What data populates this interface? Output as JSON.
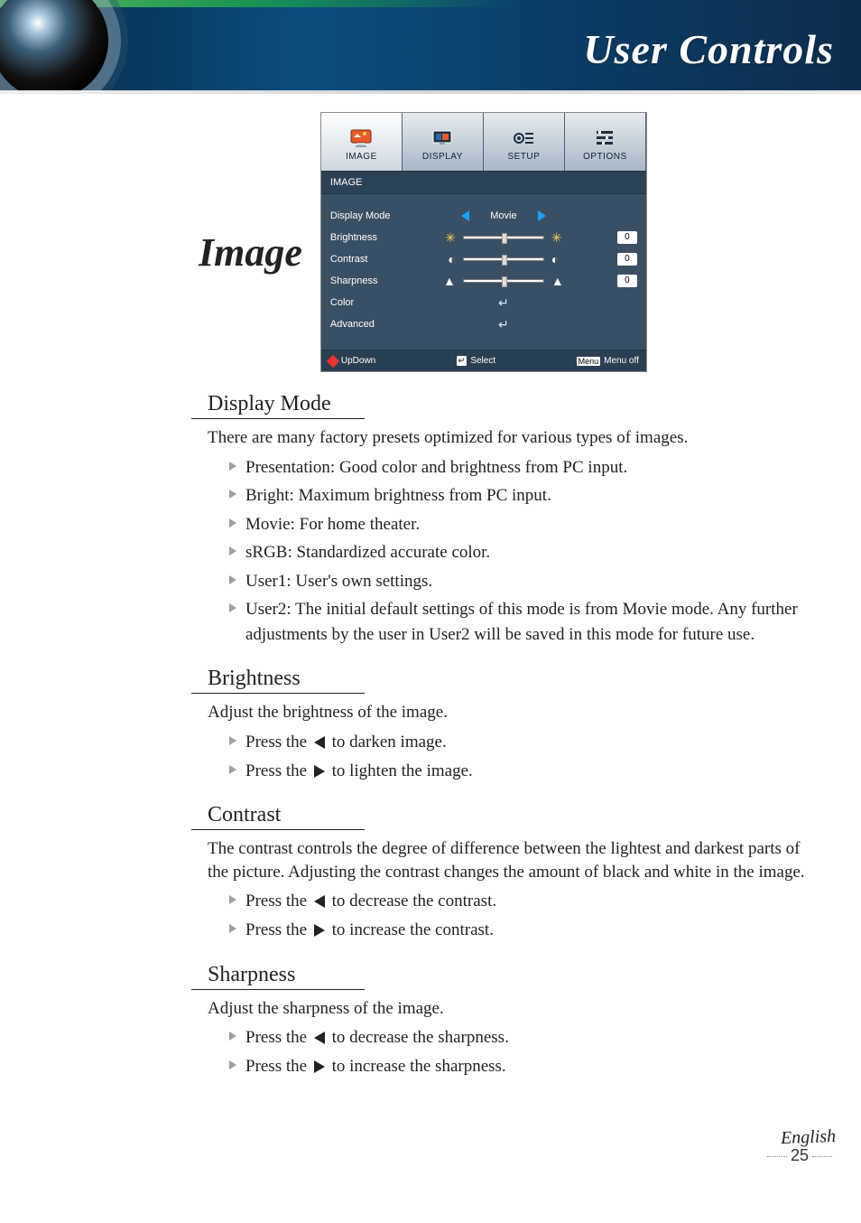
{
  "header": {
    "title": "User Controls"
  },
  "section_name": "Image",
  "osd": {
    "tabs": [
      {
        "label": "IMAGE"
      },
      {
        "label": "DISPLAY"
      },
      {
        "label": "SETUP"
      },
      {
        "label": "OPTIONS"
      }
    ],
    "subhead": "IMAGE",
    "rows": {
      "display_mode": {
        "label": "Display Mode",
        "value": "Movie"
      },
      "brightness": {
        "label": "Brightness",
        "value": "0"
      },
      "contrast": {
        "label": "Contrast",
        "value": "0"
      },
      "sharpness": {
        "label": "Sharpness",
        "value": "0"
      },
      "color": {
        "label": "Color"
      },
      "advanced": {
        "label": "Advanced"
      }
    },
    "footer": {
      "updown": "UpDown",
      "select": "Select",
      "menu_badge": "Menu",
      "menu_off": "Menu off"
    }
  },
  "sections": {
    "display_mode": {
      "heading": "Display Mode",
      "intro": "There are many factory presets optimized for various types of images.",
      "items": [
        "Presentation: Good color and brightness from PC input.",
        "Bright: Maximum brightness from PC input.",
        "Movie: For home theater.",
        "sRGB: Standardized accurate color.",
        "User1: User's own settings.",
        "User2: The initial default settings of this mode is from Movie mode. Any further adjustments by the user in User2 will be saved in this mode for future use."
      ]
    },
    "brightness": {
      "heading": "Brightness",
      "intro": "Adjust the brightness of the image.",
      "left_pre": "Press the ",
      "left_post": " to darken image.",
      "right_pre": "Press the ",
      "right_post": " to lighten the image."
    },
    "contrast": {
      "heading": "Contrast",
      "intro": "The contrast controls the degree of difference between the lightest and darkest parts of the picture. Adjusting the contrast changes the amount of black and white in the image.",
      "left_pre": "Press the ",
      "left_post": " to decrease the contrast.",
      "right_pre": "Press the ",
      "right_post": " to increase the contrast."
    },
    "sharpness": {
      "heading": "Sharpness",
      "intro": "Adjust the sharpness of the image.",
      "left_pre": "Press the ",
      "left_post": " to decrease the sharpness.",
      "right_pre": "Press the ",
      "right_post": " to increase the sharpness."
    }
  },
  "footer": {
    "language": "English",
    "page": "25"
  }
}
